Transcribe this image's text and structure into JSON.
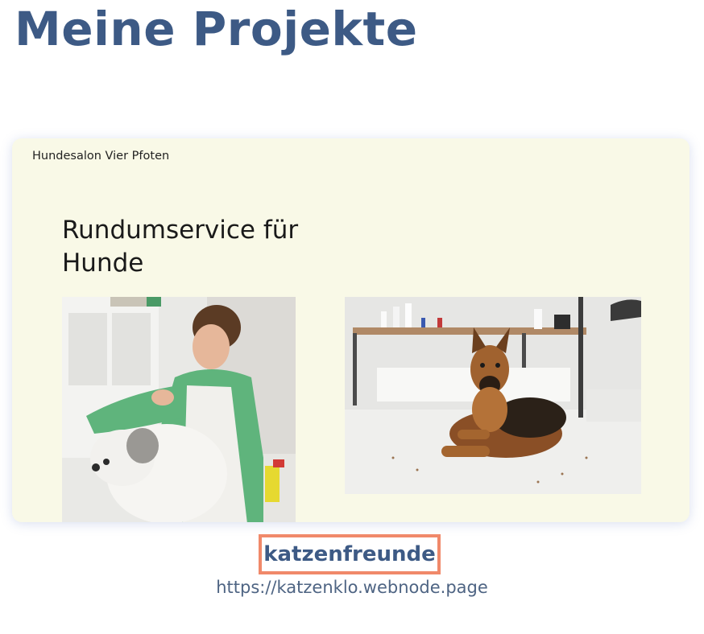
{
  "page": {
    "title": "Meine Projekte"
  },
  "project": {
    "preview": {
      "brand": "Hundesalon Vier Pfoten",
      "headline": "Rundumservice für Hunde"
    },
    "name": "katzenfreunde",
    "url": "https://katzenklo.webnode.page"
  },
  "colors": {
    "title": "#3d5a85",
    "card_background": "#f9f9e7",
    "highlight_border": "#f0896a",
    "url_text": "#4e6483"
  }
}
